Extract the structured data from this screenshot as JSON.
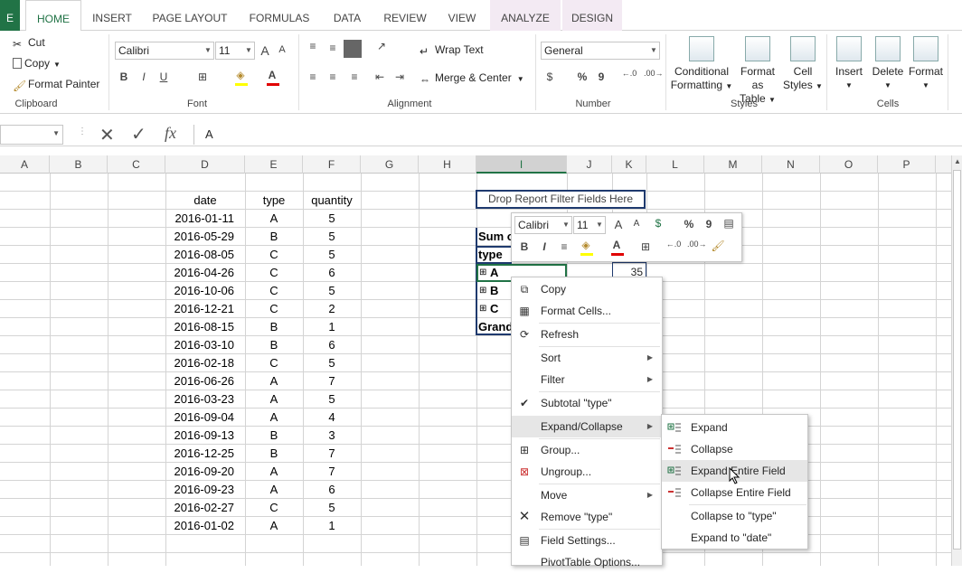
{
  "tabs": {
    "file": "E",
    "home": "HOME",
    "insert": "INSERT",
    "page_layout": "PAGE LAYOUT",
    "formulas": "FORMULAS",
    "data": "DATA",
    "review": "REVIEW",
    "view": "VIEW",
    "analyze": "ANALYZE",
    "design": "DESIGN"
  },
  "clipboard": {
    "cut": "Cut",
    "copy": "Copy",
    "format_painter": "Format Painter",
    "label": "Clipboard"
  },
  "font": {
    "name": "Calibri",
    "size": "11",
    "label": "Font",
    "bold": "B",
    "italic": "I",
    "underline": "U",
    "grow": "A",
    "shrink": "A"
  },
  "alignment": {
    "wrap_text": "Wrap Text",
    "merge_center": "Merge & Center",
    "label": "Alignment"
  },
  "number": {
    "format": "General",
    "percent": "%",
    "comma": "9",
    "label": "Number"
  },
  "styles": {
    "conditional_line1": "Conditional",
    "conditional_line2": "Formatting",
    "format_table_line1": "Format as",
    "format_table_line2": "Table",
    "cell_styles_line1": "Cell",
    "cell_styles_line2": "Styles",
    "label": "Styles"
  },
  "cells": {
    "insert": "Insert",
    "delete": "Delete",
    "format": "Format",
    "label": "Cells"
  },
  "formula_bar": {
    "value": "A",
    "fx": "fx"
  },
  "columns": [
    "A",
    "B",
    "C",
    "D",
    "E",
    "F",
    "G",
    "H",
    "I",
    "J",
    "K",
    "L",
    "M",
    "N",
    "O",
    "P"
  ],
  "table": {
    "headers": {
      "date": "date",
      "type": "type",
      "quantity": "quantity"
    },
    "rows": [
      {
        "date": "2016-01-11",
        "type": "A",
        "quantity": "5"
      },
      {
        "date": "2016-05-29",
        "type": "B",
        "quantity": "5"
      },
      {
        "date": "2016-08-05",
        "type": "C",
        "quantity": "5"
      },
      {
        "date": "2016-04-26",
        "type": "C",
        "quantity": "6"
      },
      {
        "date": "2016-10-06",
        "type": "C",
        "quantity": "5"
      },
      {
        "date": "2016-12-21",
        "type": "C",
        "quantity": "2"
      },
      {
        "date": "2016-08-15",
        "type": "B",
        "quantity": "1"
      },
      {
        "date": "2016-03-10",
        "type": "B",
        "quantity": "6"
      },
      {
        "date": "2016-02-18",
        "type": "C",
        "quantity": "5"
      },
      {
        "date": "2016-06-26",
        "type": "A",
        "quantity": "7"
      },
      {
        "date": "2016-03-23",
        "type": "A",
        "quantity": "5"
      },
      {
        "date": "2016-09-04",
        "type": "A",
        "quantity": "4"
      },
      {
        "date": "2016-09-13",
        "type": "B",
        "quantity": "3"
      },
      {
        "date": "2016-12-25",
        "type": "B",
        "quantity": "7"
      },
      {
        "date": "2016-09-20",
        "type": "A",
        "quantity": "7"
      },
      {
        "date": "2016-09-23",
        "type": "A",
        "quantity": "6"
      },
      {
        "date": "2016-02-27",
        "type": "C",
        "quantity": "5"
      },
      {
        "date": "2016-01-02",
        "type": "A",
        "quantity": "1"
      }
    ]
  },
  "pivot": {
    "filter_drop": "Drop Report Filter Fields Here",
    "sum_label": "Sum o",
    "type_label": "type",
    "item_a": "A",
    "item_b": "B",
    "item_c": "C",
    "grand": "Grand",
    "value_a": "35",
    "expand_glyph": "⊞"
  },
  "mini_toolbar": {
    "font": "Calibri",
    "size": "11",
    "bold": "B",
    "italic": "I",
    "percent": "%",
    "comma": "9"
  },
  "context_menu": {
    "copy": "Copy",
    "format_cells": "Format Cells...",
    "refresh": "Refresh",
    "sort": "Sort",
    "filter": "Filter",
    "subtotal": "Subtotal \"type\"",
    "expand_collapse": "Expand/Collapse",
    "group": "Group...",
    "ungroup": "Ungroup...",
    "move": "Move",
    "remove": "Remove \"type\"",
    "field_settings": "Field Settings...",
    "pivot_options": "PivotTable Options..."
  },
  "submenu": {
    "expand": "Expand",
    "collapse": "Collapse",
    "expand_entire": "Expand Entire Field",
    "collapse_entire": "Collapse Entire Field",
    "collapse_to": "Collapse to \"type\"",
    "expand_to": "Expand to \"date\""
  },
  "colors": {
    "accent": "#217346",
    "pivot_border": "#1f3a6e",
    "highlight": "#e6e6e6"
  }
}
